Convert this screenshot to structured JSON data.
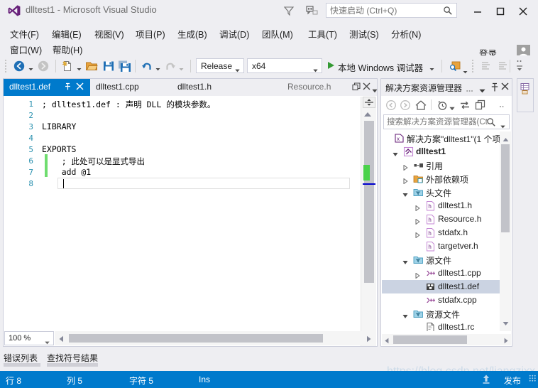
{
  "window": {
    "title": "dlltest1 - Microsoft Visual Studio",
    "logo_icon": "visual-studio-logo",
    "minimize_icon": "minimize-icon",
    "maximize_icon": "maximize-icon",
    "close_icon": "close-icon",
    "accent_color": "#007ACC",
    "chrome_color": "#EEEEF2"
  },
  "quick_launch": {
    "placeholder": "快速启动 (Ctrl+Q)",
    "value": "",
    "icon": "search-icon"
  },
  "menu": {
    "row1": [
      "文件(F)",
      "编辑(E)",
      "视图(V)",
      "项目(P)",
      "生成(B)",
      "调试(D)",
      "团队(M)",
      "工具(T)",
      "测试(S)",
      "分析(N)"
    ],
    "row2": [
      "窗口(W)",
      "帮助(H)"
    ],
    "signin": "登录"
  },
  "toolbar": {
    "config": {
      "value": "Release"
    },
    "platform": {
      "value": "x64"
    },
    "run": {
      "label": "本地 Windows 调试器"
    },
    "icons": [
      "navigate-back-icon",
      "navigate-forward-icon",
      "new-project-icon",
      "open-file-icon",
      "save-icon",
      "save-all-icon",
      "undo-icon",
      "redo-icon",
      "find-in-files-icon",
      "comment-icon",
      "uncomment-icon"
    ]
  },
  "editor": {
    "tabs": [
      {
        "label": "dlltest1.def",
        "active": true,
        "pin_icon": "pin-icon",
        "close_icon": "close-icon"
      },
      {
        "label": "dlltest1.cpp",
        "active": false
      },
      {
        "label": "dlltest1.h",
        "active": false
      },
      {
        "label": "Resource.h",
        "active": false
      }
    ],
    "tabstrip_icons": [
      "restore-icon",
      "close-icon",
      "tab-list-icon"
    ],
    "lines": [
      {
        "n": "1",
        "text": "; dlltest1.def : 声明 DLL 的模块参数。"
      },
      {
        "n": "2",
        "text": ""
      },
      {
        "n": "3",
        "text": "LIBRARY"
      },
      {
        "n": "4",
        "text": ""
      },
      {
        "n": "5",
        "text": "EXPORTS"
      },
      {
        "n": "6",
        "text": "    ; 此处可以是显式导出"
      },
      {
        "n": "7",
        "text": "    add @1"
      },
      {
        "n": "8",
        "text": ""
      }
    ],
    "zoom": {
      "value": "100 %"
    }
  },
  "solution_explorer": {
    "title": "解决方案资源管理器",
    "title_icons": [
      "float-icon",
      "dropdown-icon",
      "pin-icon",
      "close-icon"
    ],
    "toolbar_icons": [
      "back-icon",
      "forward-icon",
      "home-icon",
      "pending-changes-icon",
      "sync-icon",
      "collapse-all-icon",
      "overflow-icon"
    ],
    "search": {
      "placeholder": "搜索解决方案资源管理器(Ct",
      "value": "",
      "icon": "search-icon",
      "dropdown_icon": "chevron-down-icon"
    },
    "tree": [
      {
        "label": "解决方案\"dlltest1\"(1 个项",
        "depth": 0,
        "twisty": "none",
        "icon": "solution-icon",
        "bold": false,
        "selected": false
      },
      {
        "label": "dlltest1",
        "depth": 1,
        "twisty": "expanded",
        "icon": "project-icon",
        "bold": true,
        "selected": false
      },
      {
        "label": "引用",
        "depth": 2,
        "twisty": "collapsed",
        "icon": "references-icon",
        "bold": false,
        "selected": false
      },
      {
        "label": "外部依赖项",
        "depth": 2,
        "twisty": "collapsed",
        "icon": "ext-deps-icon",
        "bold": false,
        "selected": false
      },
      {
        "label": "头文件",
        "depth": 2,
        "twisty": "expanded",
        "icon": "filter-folder-icon",
        "bold": false,
        "selected": false
      },
      {
        "label": "dlltest1.h",
        "depth": 3,
        "twisty": "collapsed",
        "icon": "header-file-icon",
        "bold": false,
        "selected": false
      },
      {
        "label": "Resource.h",
        "depth": 3,
        "twisty": "collapsed",
        "icon": "header-file-icon",
        "bold": false,
        "selected": false
      },
      {
        "label": "stdafx.h",
        "depth": 3,
        "twisty": "collapsed",
        "icon": "header-file-icon",
        "bold": false,
        "selected": false
      },
      {
        "label": "targetver.h",
        "depth": 3,
        "twisty": "none",
        "icon": "header-file-icon",
        "bold": false,
        "selected": false
      },
      {
        "label": "源文件",
        "depth": 2,
        "twisty": "expanded",
        "icon": "filter-folder-icon",
        "bold": false,
        "selected": false
      },
      {
        "label": "dlltest1.cpp",
        "depth": 3,
        "twisty": "collapsed",
        "icon": "cpp-file-icon",
        "bold": false,
        "selected": false
      },
      {
        "label": "dlltest1.def",
        "depth": 3,
        "twisty": "none",
        "icon": "def-file-icon",
        "bold": false,
        "selected": true
      },
      {
        "label": "stdafx.cpp",
        "depth": 3,
        "twisty": "none",
        "icon": "cpp-file-icon",
        "bold": false,
        "selected": false
      },
      {
        "label": "资源文件",
        "depth": 2,
        "twisty": "expanded",
        "icon": "filter-folder-icon",
        "bold": false,
        "selected": false
      },
      {
        "label": "dlltest1.rc",
        "depth": 3,
        "twisty": "none",
        "icon": "rc-file-icon",
        "bold": false,
        "selected": false
      }
    ]
  },
  "right_dock": {
    "tab_icon": "properties-icon"
  },
  "bottom_tabs": [
    {
      "label": "错误列表"
    },
    {
      "label": "查找符号结果"
    }
  ],
  "status_bar": {
    "line": "行 8",
    "column": "列 5",
    "character": "字符 5",
    "insert_mode": "Ins",
    "publish": "发布"
  },
  "watermark": "https://blog.csdn.net/liangzixx"
}
